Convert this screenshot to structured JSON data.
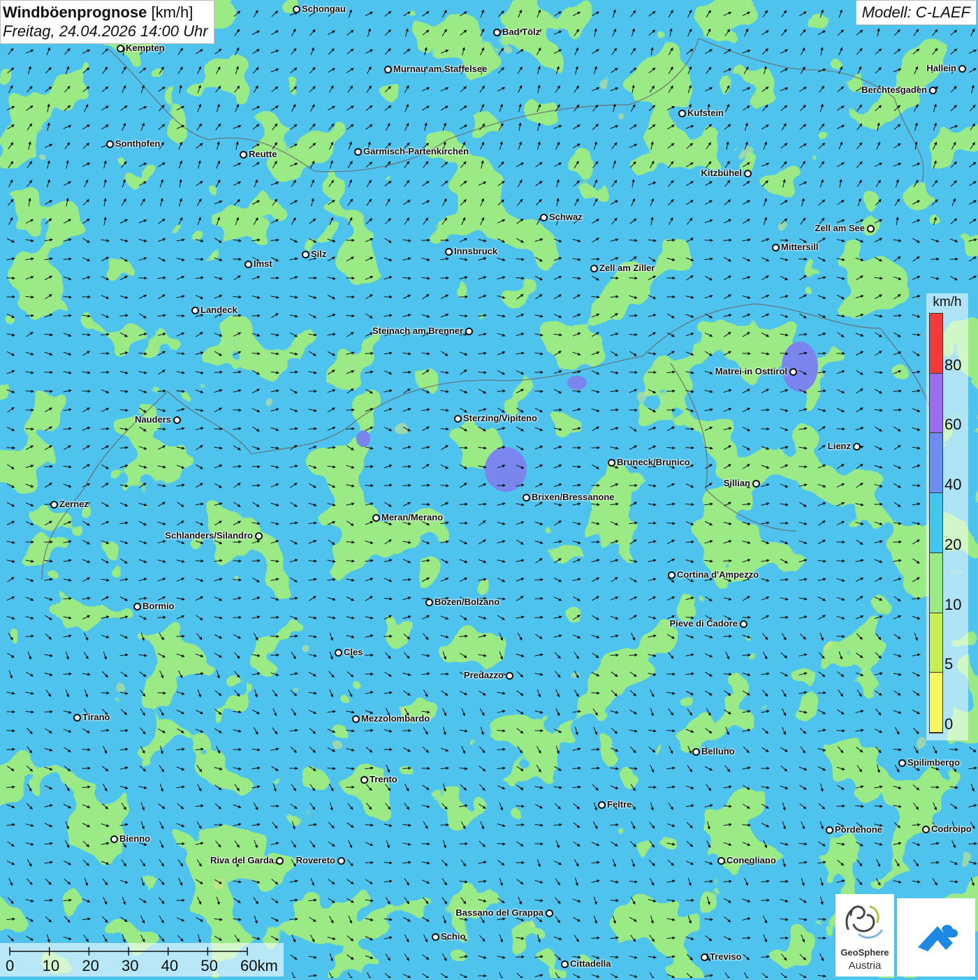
{
  "header": {
    "title_bold": "Windböenprognose",
    "title_unit": "[km/h]",
    "subtitle": "Freitag, 24.04.2026 14:00 Uhr"
  },
  "model": "Modell: C-LAEF",
  "legend": {
    "unit": "km/h",
    "levels": [
      "0",
      "5",
      "10",
      "20",
      "40",
      "60",
      "80"
    ],
    "colors": [
      "#f7f760",
      "#c8ee55",
      "#9aea86",
      "#3fc7ee",
      "#6b8ff0",
      "#9b6ef0",
      "#f23a3a"
    ],
    "background_colors": {
      "calm": "#9aea86",
      "moderate": "#4ec3ee",
      "strong": "#7a86ee",
      "weak": "#d8e87a"
    }
  },
  "scale_bar": {
    "labels": [
      "0",
      "10",
      "20",
      "30",
      "40",
      "50",
      "60km"
    ]
  },
  "logo": {
    "name": "GeoSphere",
    "sub": "Austria"
  },
  "cities": [
    {
      "name": "Schongau"
    },
    {
      "name": "Bad Tölz"
    },
    {
      "name": "Kempten"
    },
    {
      "name": "Murnau am Staffelsee"
    },
    {
      "name": "Hallein"
    },
    {
      "name": "Berchtesgaden"
    },
    {
      "name": "Kufstein"
    },
    {
      "name": "Sonthofen"
    },
    {
      "name": "Reutte"
    },
    {
      "name": "Garmisch-Partenkirchen"
    },
    {
      "name": "Kitzbühel"
    },
    {
      "name": "Schwaz"
    },
    {
      "name": "Zell am See"
    },
    {
      "name": "Mittersill"
    },
    {
      "name": "Innsbruck"
    },
    {
      "name": "Silz"
    },
    {
      "name": "Imst"
    },
    {
      "name": "Zell am Ziller"
    },
    {
      "name": "Landeck"
    },
    {
      "name": "Steinach am Brenner"
    },
    {
      "name": "Matrei in Osttirol"
    },
    {
      "name": "Nauders"
    },
    {
      "name": "Sterzing/Vipiteno"
    },
    {
      "name": "Lienz"
    },
    {
      "name": "Bruneck/Brunico"
    },
    {
      "name": "Sillian"
    },
    {
      "name": "Zernez"
    },
    {
      "name": "Brixen/Bressanone"
    },
    {
      "name": "Meran/Merano"
    },
    {
      "name": "Schlanders/Silandro"
    },
    {
      "name": "Cortina d'Ampezzo"
    },
    {
      "name": "Bozen/Bolzano"
    },
    {
      "name": "Bormio"
    },
    {
      "name": "Pieve di Cadore"
    },
    {
      "name": "Cles"
    },
    {
      "name": "Predazzo"
    },
    {
      "name": "Tirano"
    },
    {
      "name": "Mezzolombardo"
    },
    {
      "name": "Belluno"
    },
    {
      "name": "Spilimbergo"
    },
    {
      "name": "Trento"
    },
    {
      "name": "Feltre"
    },
    {
      "name": "Pordenone"
    },
    {
      "name": "Codroipo"
    },
    {
      "name": "Bienno"
    },
    {
      "name": "Riva del Garda"
    },
    {
      "name": "Rovereto"
    },
    {
      "name": "Conegliano"
    },
    {
      "name": "Bassano del Grappa"
    },
    {
      "name": "Schio"
    },
    {
      "name": "Treviso"
    },
    {
      "name": "Cittadella"
    }
  ]
}
